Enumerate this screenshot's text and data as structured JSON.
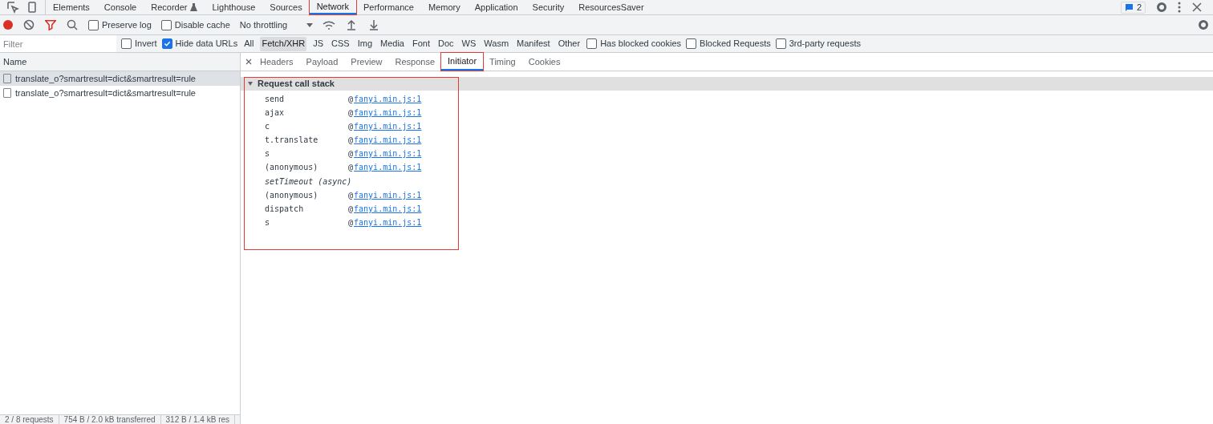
{
  "panel_tabs": [
    {
      "label": "Elements",
      "selected": false
    },
    {
      "label": "Console",
      "selected": false
    },
    {
      "label": "Recorder",
      "selected": false,
      "flask": true
    },
    {
      "label": "Lighthouse",
      "selected": false
    },
    {
      "label": "Sources",
      "selected": false
    },
    {
      "label": "Network",
      "selected": true
    },
    {
      "label": "Performance",
      "selected": false
    },
    {
      "label": "Memory",
      "selected": false
    },
    {
      "label": "Application",
      "selected": false
    },
    {
      "label": "Security",
      "selected": false
    },
    {
      "label": "ResourcesSaver",
      "selected": false
    }
  ],
  "issues_badge": "2",
  "toolbar": {
    "recording": true,
    "filter_active": true,
    "preserve_log": {
      "label": "Preserve log",
      "checked": false
    },
    "disable_cache": {
      "label": "Disable cache",
      "checked": false
    },
    "throttling": "No throttling"
  },
  "filter_bar": {
    "placeholder": "Filter",
    "invert": {
      "label": "Invert",
      "checked": false
    },
    "hide_data_urls": {
      "label": "Hide data URLs",
      "checked": true
    },
    "types": [
      {
        "label": "All",
        "selected": false
      },
      {
        "label": "Fetch/XHR",
        "selected": true
      },
      {
        "label": "JS",
        "selected": false
      },
      {
        "label": "CSS",
        "selected": false
      },
      {
        "label": "Img",
        "selected": false
      },
      {
        "label": "Media",
        "selected": false
      },
      {
        "label": "Font",
        "selected": false
      },
      {
        "label": "Doc",
        "selected": false
      },
      {
        "label": "WS",
        "selected": false
      },
      {
        "label": "Wasm",
        "selected": false
      },
      {
        "label": "Manifest",
        "selected": false
      },
      {
        "label": "Other",
        "selected": false
      }
    ],
    "options": [
      {
        "label": "Has blocked cookies",
        "checked": false
      },
      {
        "label": "Blocked Requests",
        "checked": false
      },
      {
        "label": "3rd-party requests",
        "checked": false
      }
    ]
  },
  "requests": {
    "column": "Name",
    "rows": [
      {
        "name": "translate_o?smartresult=dict&smartresult=rule",
        "selected": true
      },
      {
        "name": "translate_o?smartresult=dict&smartresult=rule",
        "selected": false
      }
    ]
  },
  "detail_tabs": [
    {
      "label": "Headers",
      "selected": false
    },
    {
      "label": "Payload",
      "selected": false
    },
    {
      "label": "Preview",
      "selected": false
    },
    {
      "label": "Response",
      "selected": false
    },
    {
      "label": "Initiator",
      "selected": true
    },
    {
      "label": "Timing",
      "selected": false
    },
    {
      "label": "Cookies",
      "selected": false
    }
  ],
  "call_stack": {
    "title": "Request call stack",
    "expanded": true,
    "frames": [
      {
        "kind": "frame",
        "function": "send",
        "at": "@",
        "source": "fanyi.min.js:1"
      },
      {
        "kind": "frame",
        "function": "ajax",
        "at": "@",
        "source": "fanyi.min.js:1"
      },
      {
        "kind": "frame",
        "function": "c",
        "at": "@",
        "source": "fanyi.min.js:1"
      },
      {
        "kind": "frame",
        "function": "t.translate",
        "at": "@",
        "source": "fanyi.min.js:1"
      },
      {
        "kind": "frame",
        "function": "s",
        "at": "@",
        "source": "fanyi.min.js:1"
      },
      {
        "kind": "frame",
        "function": "(anonymous)",
        "at": "@",
        "source": "fanyi.min.js:1"
      },
      {
        "kind": "async",
        "function": "setTimeout (async)"
      },
      {
        "kind": "frame",
        "function": "(anonymous)",
        "at": "@",
        "source": "fanyi.min.js:1"
      },
      {
        "kind": "frame",
        "function": "dispatch",
        "at": "@",
        "source": "fanyi.min.js:1"
      },
      {
        "kind": "frame",
        "function": "s",
        "at": "@",
        "source": "fanyi.min.js:1"
      }
    ]
  },
  "status_bar": [
    "2 / 8 requests",
    "754 B / 2.0 kB transferred",
    "312 B / 1.4 kB res"
  ]
}
